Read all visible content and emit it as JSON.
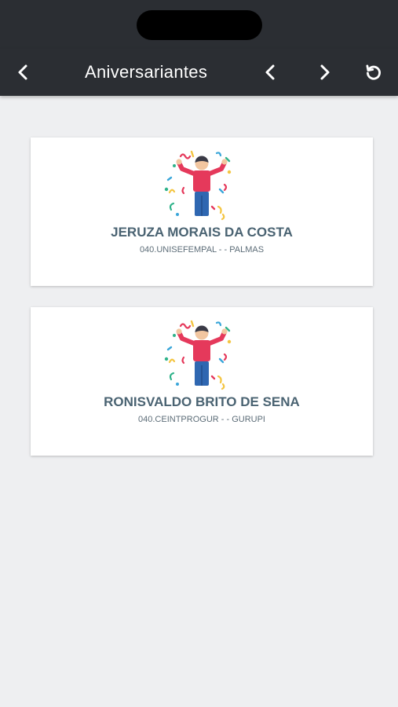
{
  "header": {
    "title": "Aniversariantes",
    "back_icon": "chevron-left-icon",
    "prev_icon": "chevron-left-icon",
    "next_icon": "chevron-right-icon",
    "refresh_icon": "refresh-icon",
    "background_color": "#2b2e33"
  },
  "birthdays": [
    {
      "name": "JERUZA MORAIS DA COSTA",
      "unit": "040.UNISEFEMPAL - - PALMAS",
      "icon": "celebration-person-icon"
    },
    {
      "name": "RONISVALDO BRITO DE SENA",
      "unit": "040.CEINTPROGUR - - GURUPI",
      "icon": "celebration-person-icon"
    }
  ],
  "colors": {
    "name_text": "#4a6372",
    "person_shirt": "#e5395b",
    "person_pants": "#2f67b1",
    "page_background": "#eeeff1"
  }
}
